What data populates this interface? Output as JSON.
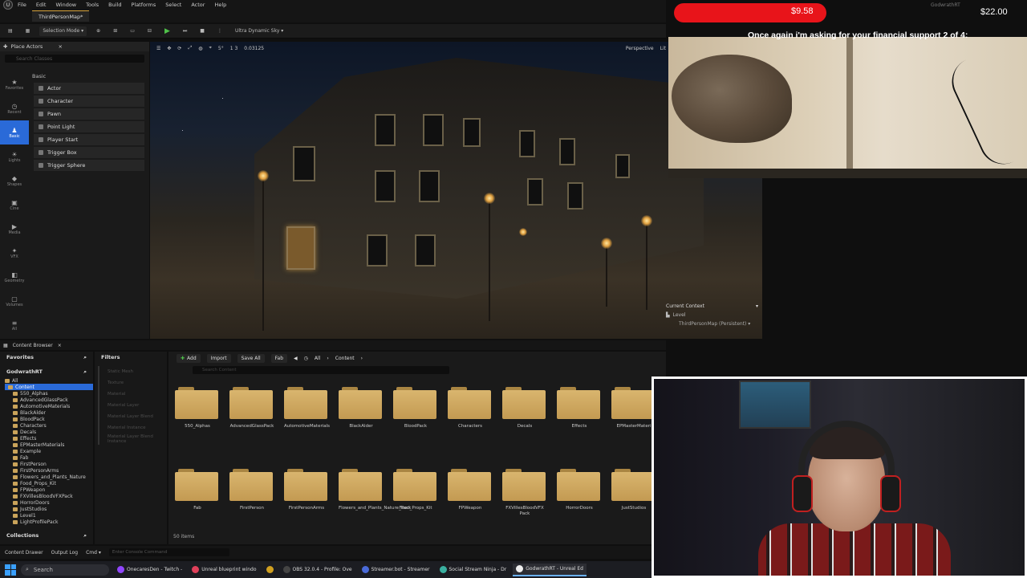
{
  "editor": {
    "logo_glyph": "U",
    "menu": [
      "File",
      "Edit",
      "Window",
      "Tools",
      "Build",
      "Platforms",
      "Select",
      "Actor",
      "Help"
    ],
    "map_tab": "ThirdPersonMap*",
    "toolbar": {
      "save_icon": "save-icon",
      "selection_mode": "Selection Mode ▾",
      "ultra_dynamic_sky": "Ultra Dynamic Sky ▾"
    },
    "viewport": {
      "perspective": "Perspective",
      "lit": "Lit",
      "speed": "0.03125",
      "scale_readout": "1 3",
      "grid_readout": "5°",
      "current_context": {
        "title": "Current Context",
        "level_label": "Level",
        "level_value": "ThirdPersonMap (Persistent) ▾"
      }
    },
    "place_actors": {
      "title": "Place Actors",
      "search_placeholder": "Search Classes",
      "category": "Basic",
      "side_tabs": [
        {
          "label": "Favorites",
          "glyph": "★"
        },
        {
          "label": "Recent",
          "glyph": "◷"
        },
        {
          "label": "Basic",
          "glyph": "♟"
        },
        {
          "label": "Lights",
          "glyph": "☀"
        },
        {
          "label": "Shapes",
          "glyph": "◆"
        },
        {
          "label": "Cine",
          "glyph": "▣"
        },
        {
          "label": "Media",
          "glyph": "▶"
        },
        {
          "label": "VFX",
          "glyph": "✦"
        },
        {
          "label": "Geometry",
          "glyph": "◧"
        },
        {
          "label": "Volumes",
          "glyph": "▢"
        },
        {
          "label": "All",
          "glyph": "≡"
        }
      ],
      "items": [
        "Actor",
        "Character",
        "Pawn",
        "Point Light",
        "Player Start",
        "Trigger Box",
        "Trigger Sphere"
      ]
    },
    "content_browser": {
      "tab": "Content Browser",
      "favorites": "Favorites",
      "project": "GodwrathRT",
      "filters": "Filters",
      "filter_items": [
        "Static Mesh",
        "Texture",
        "Material",
        "Material Layer",
        "Material Layer Blend",
        "Material Instance",
        "Material Layer Blend Instance"
      ],
      "tree": [
        "All",
        "Content",
        "550_Alphas",
        "AdvancedGlassPack",
        "AutomotiveMaterials",
        "BlackAlder",
        "BloodPack",
        "Characters",
        "Decals",
        "Effects",
        "EPMasterMaterials",
        "Example",
        "Fab",
        "FirstPerson",
        "FirstPersonArms",
        "Flowers_and_Plants_Nature",
        "Food_Props_Kit",
        "FPWeapon",
        "FXVillesBloodVFXPack",
        "HorrorDoors",
        "JustStudios",
        "Level1",
        "LightProfilePack"
      ],
      "collections": "Collections",
      "add": "Add",
      "import": "Import",
      "save_all": "Save All",
      "fab": "Fab",
      "path": [
        "All",
        "Content"
      ],
      "search_placeholder": "Search Content",
      "folders_row1": [
        "550_Alphas",
        "AdvancedGlassPack",
        "AutomotiveMaterials",
        "BlackAlder",
        "BloodPack",
        "Characters",
        "Decals",
        "Effects",
        "EPMasterMateri"
      ],
      "folders_row2": [
        "Fab",
        "FirstPerson",
        "FirstPersonArms",
        "Flowers_and_Plants_Nature_Pack",
        "Food_Props_Kit",
        "FPWeapon",
        "FXVillesBloodVFX Pack",
        "HorrorDoors",
        "JustStudios"
      ],
      "items_count": "50 items"
    },
    "bottom_bar": {
      "content_drawer": "Content Drawer",
      "output_log": "Output Log",
      "cmd": "Cmd ▾",
      "console_placeholder": "Enter Console Command"
    }
  },
  "stream": {
    "donation_amount": "$9.58",
    "goal_amount": "$22.00",
    "streamer_name": "GodwrathRT",
    "ask_text": "Once again i'm asking for your financial support 2 of 4:",
    "donation_color": "#e8141a"
  },
  "taskbar": {
    "search": "Search",
    "tasks": [
      {
        "label": "OnecaresDen - Twitch -",
        "color": "#9146ff"
      },
      {
        "label": "Unreal blueprint windo",
        "color": "#e0405a"
      },
      {
        "label": "",
        "color": "#d0a020"
      },
      {
        "label": "OBS 32.0.4 - Profile: Ove",
        "color": "#444"
      },
      {
        "label": "Streamer.bot - Streamer",
        "color": "#4a6ad8"
      },
      {
        "label": "Social Stream Ninja - Dr",
        "color": "#3ab0a0"
      },
      {
        "label": "GodwrathRT - Unreal Ed",
        "color": "#eeeeee"
      }
    ]
  }
}
